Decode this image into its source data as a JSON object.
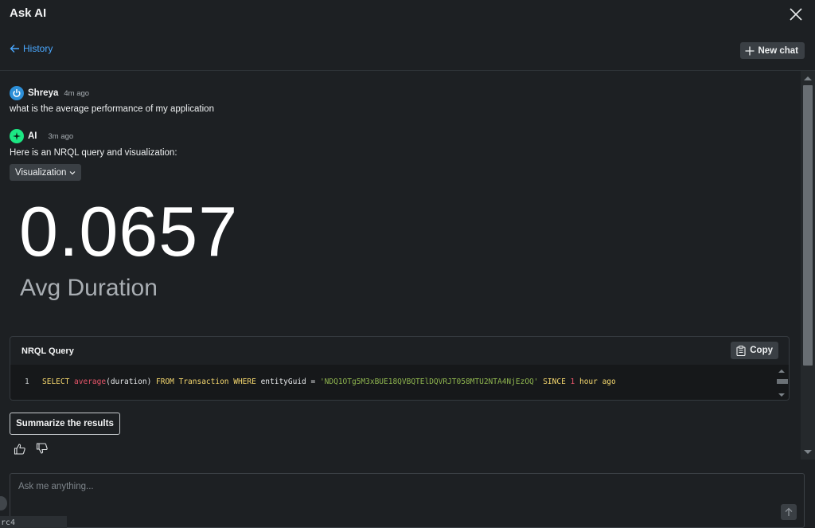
{
  "header": {
    "title": "Ask AI",
    "history_label": "History",
    "new_chat_label": "New chat"
  },
  "messages": [
    {
      "author": "Shreya",
      "time": "4m ago",
      "text": "what is the average performance of my application"
    },
    {
      "author": "AI",
      "time": "3m ago",
      "text": "Here is an NRQL query and visualization:"
    }
  ],
  "visualization": {
    "dropdown_label": "Visualization",
    "value": "0.0657",
    "label": "Avg Duration"
  },
  "nrql": {
    "title": "NRQL Query",
    "copy_label": "Copy",
    "line_number": "1",
    "tokens": {
      "select": "SELECT ",
      "fn": "average",
      "args": "(duration) ",
      "from": "FROM Transaction WHERE ",
      "field": "entityGuid = ",
      "guid": "'NDQ1OTg5M3xBUE18QVBQTElDQVRJT058MTU2NTA4NjEzOQ'",
      "since": " SINCE ",
      "num": "1",
      "unit": " hour ago"
    }
  },
  "actions": {
    "summarize_label": "Summarize the results"
  },
  "input": {
    "placeholder": "Ask me anything..."
  },
  "bottom_tab": {
    "text": "rc4"
  },
  "colors": {
    "background": "#1d2023",
    "accent_link": "#4aa8ff",
    "ai_avatar": "#1ce783",
    "user_avatar": "#2d8fd8"
  }
}
